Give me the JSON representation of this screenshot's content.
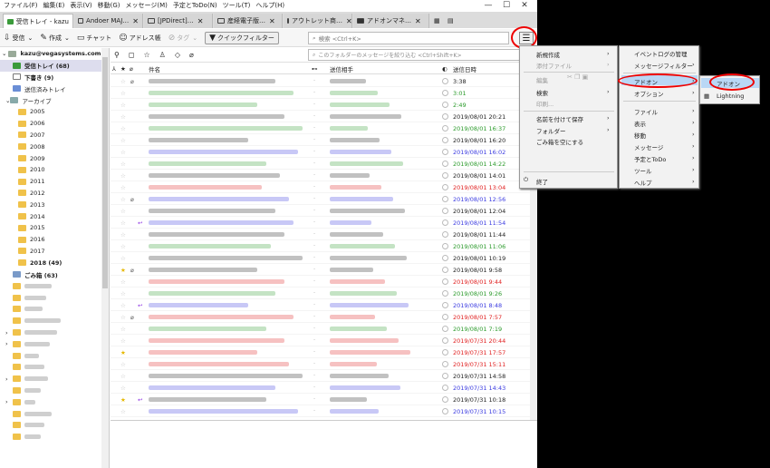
{
  "menubar": [
    "ファイル(F)",
    "編集(E)",
    "表示(V)",
    "移動(G)",
    "メッセージ(M)",
    "予定とToDo(N)",
    "ツール(T)",
    "ヘルプ(H)"
  ],
  "window_controls": {
    "min": "—",
    "max": "☐",
    "close": "✕"
  },
  "tabs": [
    {
      "label": "受信トレイ - kazu",
      "active": true
    },
    {
      "label": "Andoer MAJ…"
    },
    {
      "label": "[JPDirect]…"
    },
    {
      "label": "産経電子版…"
    },
    {
      "label": "アウトレット商…"
    },
    {
      "label": "アドオンマネ…"
    }
  ],
  "toolbar": {
    "receive": "受信",
    "compose": "作成",
    "chat": "チャット",
    "addressbook": "アドレス帳",
    "tag": "タグ",
    "quickfilter": "クイックフィルター",
    "search_placeholder": "検索 <Ctrl+K>",
    "menu_button": "☰"
  },
  "folders": {
    "account": "kazu@vegasystems.com",
    "inbox": "受信トレイ (68)",
    "drafts": "下書き (9)",
    "sent": "送信済みトレイ",
    "archive": "アーカイブ",
    "years": [
      "2005",
      "2006",
      "2007",
      "2008",
      "2009",
      "2010",
      "2011",
      "2012",
      "2013",
      "2014",
      "2015",
      "2016",
      "2017",
      "2018 (49)"
    ],
    "trash": "ごみ箱 (63)"
  },
  "list": {
    "filter_placeholder": "このフォルダーのメッセージを絞り込む <Ctrl+Shift+K>",
    "col_subject": "件名",
    "col_from": "送信相手",
    "col_date": "送信日時",
    "dates": [
      "3:38",
      "3:01",
      "2:49",
      "2019/08/01 20:21",
      "2019/08/01 16:37",
      "2019/08/01 16:20",
      "2019/08/01 16:02",
      "2019/08/01 14:22",
      "2019/08/01 14:01",
      "2019/08/01 13:04",
      "2019/08/01 12:56",
      "2019/08/01 12:04",
      "2019/08/01 11:54",
      "2019/08/01 11:44",
      "2019/08/01 11:06",
      "2019/08/01 10:19",
      "2019/08/01 9:58",
      "2019/08/01 9:44",
      "2019/08/01 9:26",
      "2019/08/01 8:48",
      "2019/08/01 7:57",
      "2019/08/01 7:19",
      "2019/07/31 20:44",
      "2019/07/31 17:57",
      "2019/07/31 15:11",
      "2019/07/31 14:58",
      "2019/07/31 14:43",
      "2019/07/31 10:18",
      "2019/07/31 10:15"
    ]
  },
  "menu_main": {
    "new": "新規作成",
    "attach": "添付ファイル",
    "edit": "編集",
    "find": "検索",
    "print": "印刷...",
    "saveas": "名前を付けて保存",
    "folder": "フォルダー",
    "emptytrash": "ごみ箱を空にする",
    "quit": "終了"
  },
  "menu_sub": {
    "eventlog": "イベントログの管理",
    "msgfilter": "メッセージフィルター",
    "addons": "アドオン",
    "options": "オプション",
    "file": "ファイル",
    "view": "表示",
    "go": "移動",
    "message": "メッセージ",
    "calendar": "予定とToDo",
    "tools": "ツール",
    "help": "ヘルプ"
  },
  "menu_addons": {
    "addons": "アドオン",
    "lightning": "Lightning"
  },
  "colors": {
    "accent": "#b9d7f5",
    "highlight": "#e00000",
    "green": "#2a9a2a",
    "red": "#e02020",
    "blue": "#3a3ae0"
  }
}
